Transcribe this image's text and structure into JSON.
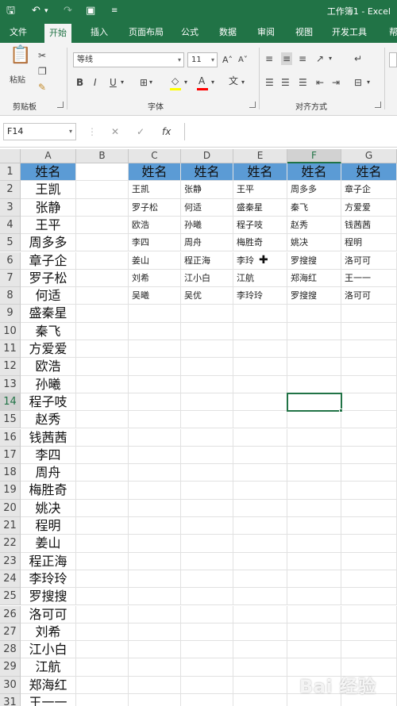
{
  "window": {
    "title": "工作簿1  -  Excel"
  },
  "quick_access": {
    "save_icon": "save-icon",
    "undo_icon": "undo-icon",
    "redo_icon": "redo-icon",
    "camera_icon": "camera-icon",
    "customize_icon": "customize-icon"
  },
  "ribbon_tabs": [
    "文件",
    "开始",
    "插入",
    "页面布局",
    "公式",
    "数据",
    "审阅",
    "视图",
    "开发工具",
    "帮"
  ],
  "active_tab": "开始",
  "ribbon": {
    "clipboard": {
      "paste_label": "粘贴",
      "group_label": "剪贴板"
    },
    "font": {
      "font_name": "等线",
      "font_size": "11",
      "group_label": "字体"
    },
    "alignment": {
      "group_label": "对齐方式"
    }
  },
  "formula_bar": {
    "name_box": "F14",
    "fx_label": "fx",
    "formula": ""
  },
  "columns": [
    "A",
    "B",
    "C",
    "D",
    "E",
    "F",
    "G"
  ],
  "selected_column": "F",
  "selected_row": 14,
  "rows": [
    {
      "n": "1",
      "a": "姓名",
      "c": "姓名",
      "d": "姓名",
      "e": "姓名",
      "f": "姓名",
      "g": "姓名"
    },
    {
      "n": "2",
      "a": "王凯",
      "c": "王凯",
      "d": "张静",
      "e": "王平",
      "f": "周多多",
      "g": "章子企"
    },
    {
      "n": "3",
      "a": "张静",
      "c": "罗子松",
      "d": "何适",
      "e": "盛秦星",
      "f": "秦飞",
      "g": "方爱爱"
    },
    {
      "n": "4",
      "a": "王平",
      "c": "欧浩",
      "d": "孙曦",
      "e": "程子吱",
      "f": "赵秀",
      "g": "钱茜茜"
    },
    {
      "n": "5",
      "a": "周多多",
      "c": "李四",
      "d": "周舟",
      "e": "梅胜奇",
      "f": "姚决",
      "g": "程明"
    },
    {
      "n": "6",
      "a": "章子企",
      "c": "姜山",
      "d": "程正海",
      "e": "李玲",
      "f": "罗搜搜",
      "g": "洛可可"
    },
    {
      "n": "7",
      "a": "罗子松",
      "c": "刘希",
      "d": "江小白",
      "e": "江航",
      "f": "郑海红",
      "g": "王一一"
    },
    {
      "n": "8",
      "a": "何适",
      "c": "吴曦",
      "d": "吴优",
      "e": "李玲玲",
      "f": "罗搜搜",
      "g": "洛可可"
    },
    {
      "n": "9",
      "a": "盛秦星"
    },
    {
      "n": "10",
      "a": "秦飞"
    },
    {
      "n": "11",
      "a": "方爱爱"
    },
    {
      "n": "12",
      "a": "欧浩"
    },
    {
      "n": "13",
      "a": "孙曦"
    },
    {
      "n": "14",
      "a": "程子吱"
    },
    {
      "n": "15",
      "a": "赵秀"
    },
    {
      "n": "16",
      "a": "钱茜茜"
    },
    {
      "n": "17",
      "a": "李四"
    },
    {
      "n": "18",
      "a": "周舟"
    },
    {
      "n": "19",
      "a": "梅胜奇"
    },
    {
      "n": "20",
      "a": "姚决"
    },
    {
      "n": "21",
      "a": "程明"
    },
    {
      "n": "22",
      "a": "姜山"
    },
    {
      "n": "23",
      "a": "程正海"
    },
    {
      "n": "24",
      "a": "李玲玲"
    },
    {
      "n": "25",
      "a": "罗搜搜"
    },
    {
      "n": "26",
      "a": "洛可可"
    },
    {
      "n": "27",
      "a": "刘希"
    },
    {
      "n": "28",
      "a": "江小白"
    },
    {
      "n": "29",
      "a": "江航"
    },
    {
      "n": "30",
      "a": "郑海红"
    },
    {
      "n": "31",
      "a": "王一一"
    }
  ],
  "colors": {
    "excel_green": "#217346",
    "header_fill": "#5b9bd5"
  },
  "watermark": "Bai 经验"
}
